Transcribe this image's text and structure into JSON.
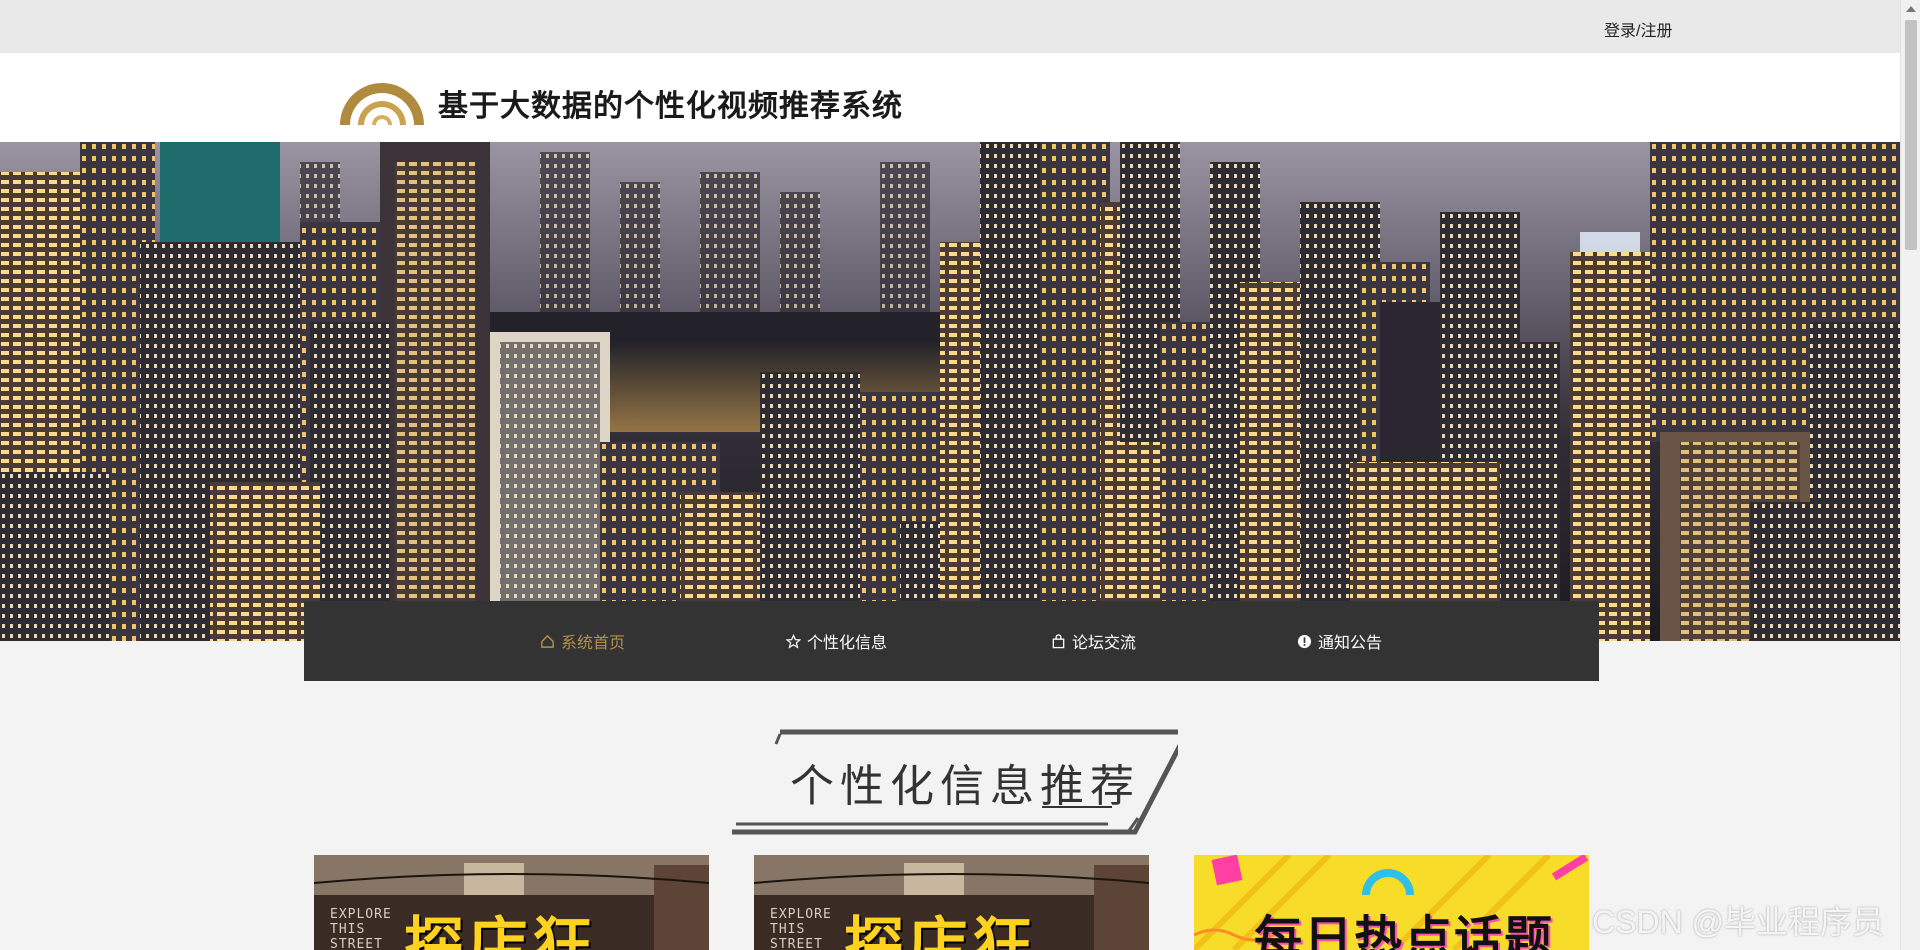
{
  "topbar": {
    "login_label": "登录/注册"
  },
  "header": {
    "title": "基于大数据的个性化视频推荐系统",
    "logo_icon": "arc-logo-icon"
  },
  "nav": {
    "items": [
      {
        "label": "系统首页",
        "icon": "home-icon",
        "active": true
      },
      {
        "label": "个性化信息",
        "icon": "star-icon",
        "active": false
      },
      {
        "label": "论坛交流",
        "icon": "bag-icon",
        "active": false
      },
      {
        "label": "通知公告",
        "icon": "info-icon",
        "active": false
      }
    ]
  },
  "section": {
    "title": "个性化信息推荐"
  },
  "cards": [
    {
      "title": "探店狂",
      "explore_text": "EXPLORE\nTHIS\nSTREET"
    },
    {
      "title": "探店狂",
      "explore_text": "EXPLORE\nTHIS\nSTREET"
    },
    {
      "title": "每日热点话题"
    }
  ],
  "watermark": "CSDN @毕业程序员",
  "colors": {
    "accent": "#b3914b",
    "nav_bg": "#333333",
    "topbar_bg": "#e9e9e9"
  }
}
